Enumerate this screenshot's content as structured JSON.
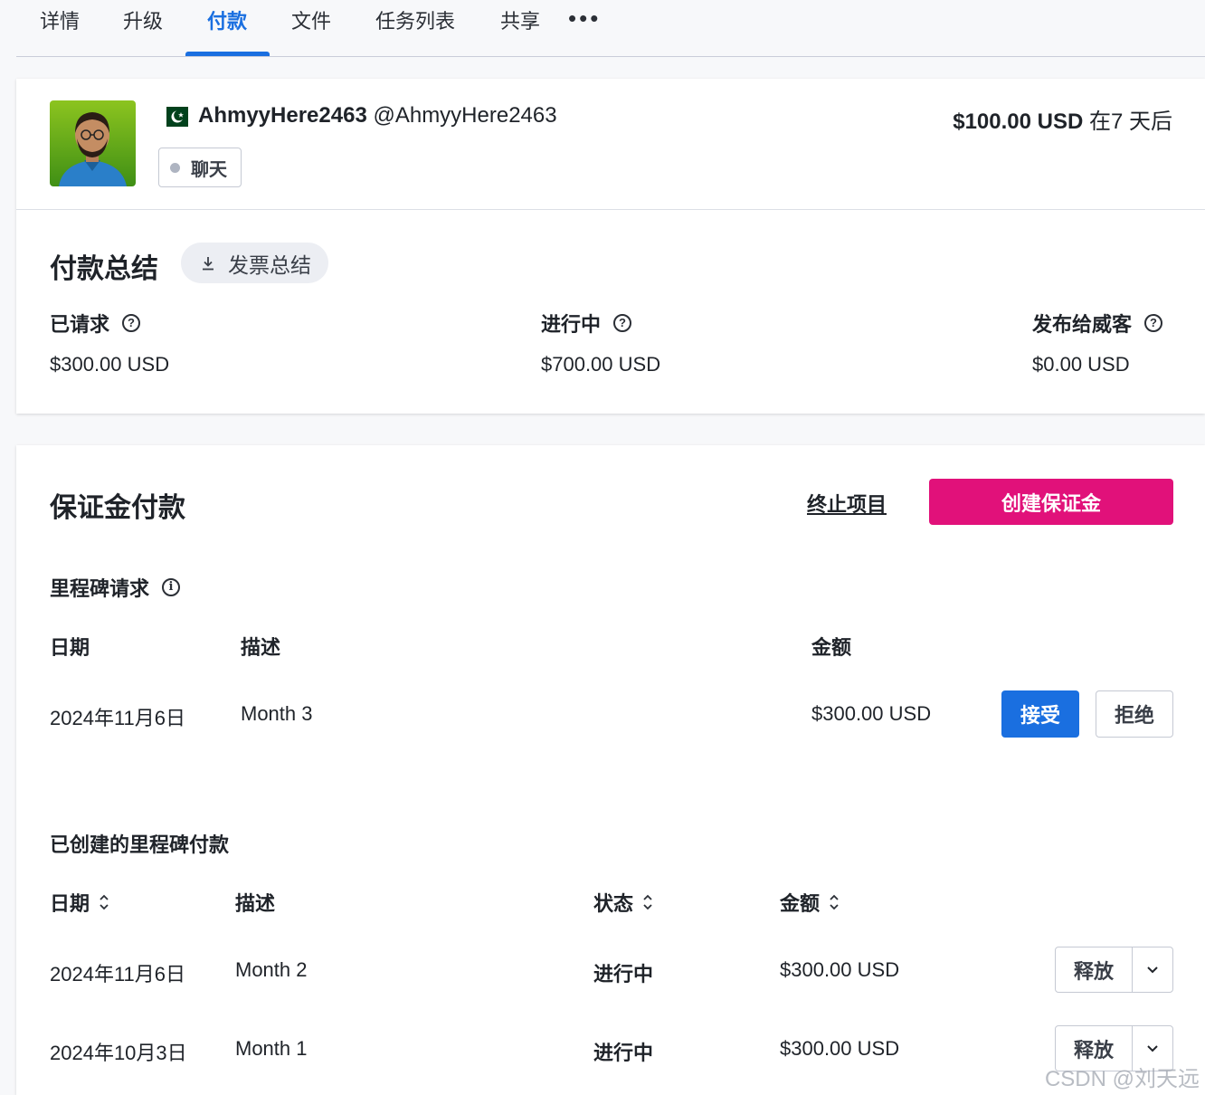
{
  "tabs": [
    {
      "label": "详情"
    },
    {
      "label": "升级"
    },
    {
      "label": "付款"
    },
    {
      "label": "文件"
    },
    {
      "label": "任务列表"
    },
    {
      "label": "共享"
    }
  ],
  "tabs_more": "•••",
  "active_tab": "付款",
  "freelancer": {
    "display_name": "AhmyyHere2463",
    "handle": "@AhmyyHere2463",
    "country_flag": "pakistan-flag-icon",
    "chat_label": "聊天"
  },
  "bid": {
    "amount": "$100.00 USD",
    "duration": "在7 天后"
  },
  "payment_summary": {
    "title": "付款总结",
    "invoice_button": "发票总结",
    "requested_label": "已请求",
    "requested_value": "$300.00 USD",
    "in_progress_label": "进行中",
    "in_progress_value": "$700.00 USD",
    "released_label": "发布给威客",
    "released_value": "$0.00 USD"
  },
  "escrow": {
    "title": "保证金付款",
    "terminate_link": "终止项目",
    "create_button": "创建保证金"
  },
  "milestone_requests": {
    "title": "里程碑请求",
    "headers": {
      "date": "日期",
      "description": "描述",
      "amount": "金额"
    },
    "rows": [
      {
        "date": "2024年11月6日",
        "description": "Month 3",
        "amount": "$300.00 USD",
        "accept": "接受",
        "reject": "拒绝"
      }
    ]
  },
  "created_milestones": {
    "title": "已创建的里程碑付款",
    "headers": {
      "date": "日期",
      "description": "描述",
      "status": "状态",
      "amount": "金额"
    },
    "rows": [
      {
        "date": "2024年11月6日",
        "description": "Month 2",
        "status": "进行中",
        "amount": "$300.00 USD",
        "release": "释放"
      },
      {
        "date": "2024年10月3日",
        "description": "Month 1",
        "status": "进行中",
        "amount": "$300.00 USD",
        "release": "释放"
      }
    ]
  },
  "watermark": "CSDN @刘天远",
  "colors": {
    "accent_blue": "#1a6fe0",
    "brand_pink": "#e1117a"
  }
}
